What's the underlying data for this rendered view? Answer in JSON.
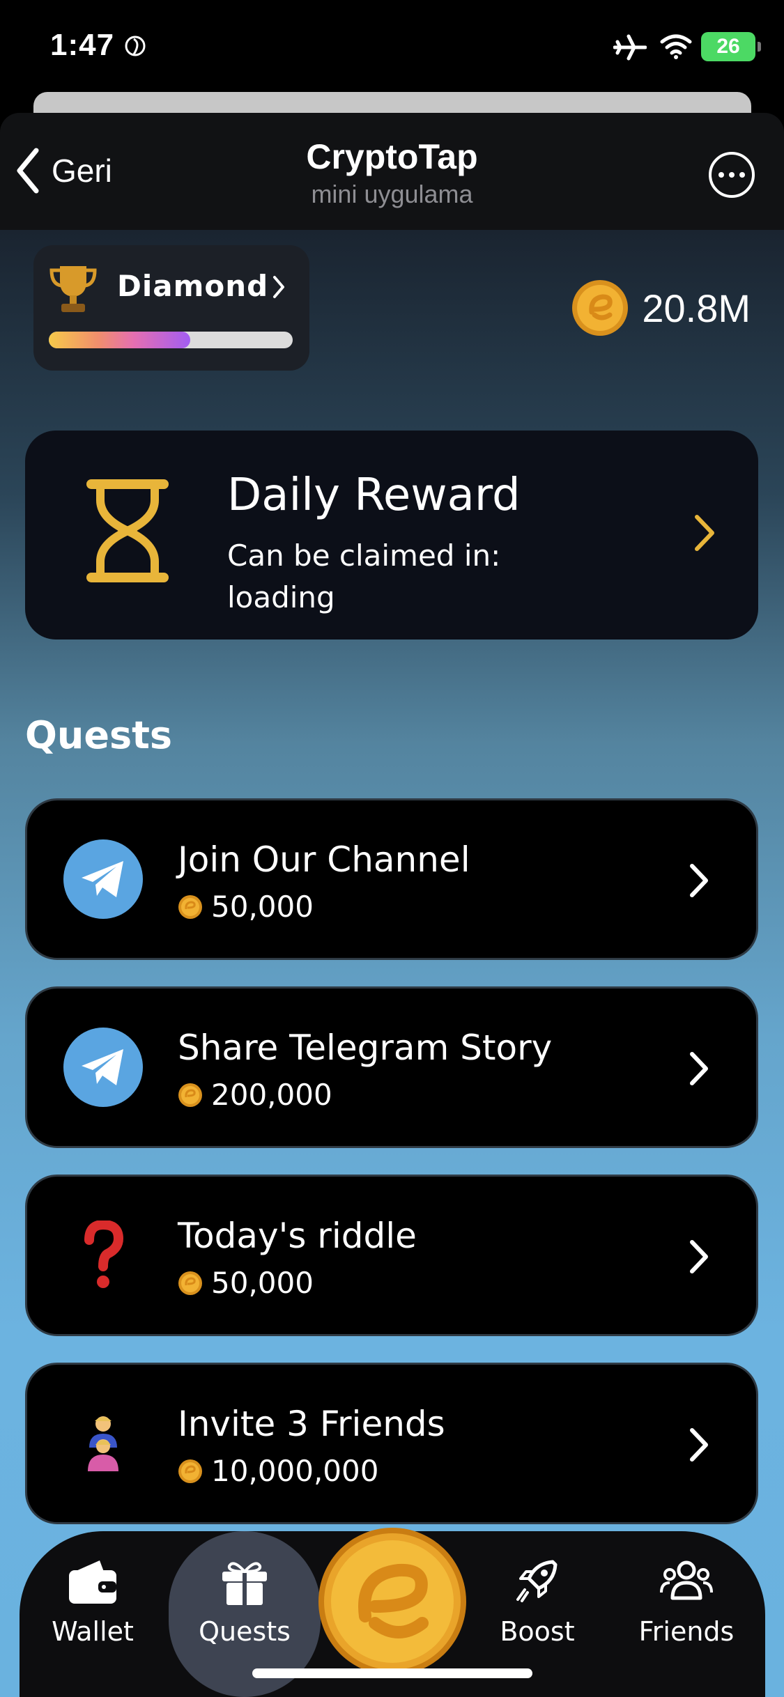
{
  "status_bar": {
    "time": "1:47",
    "battery": "26"
  },
  "header": {
    "back_label": "Geri",
    "title": "CryptoTap",
    "subtitle": "mini uygulama"
  },
  "rank": {
    "name": "Diamond",
    "progress": 0.58
  },
  "balance": {
    "value": "20.8M"
  },
  "daily_reward": {
    "title": "Daily Reward",
    "subtitle": "Can be claimed in: loading"
  },
  "quests": {
    "heading": "Quests",
    "items": [
      {
        "title": "Join Our Channel",
        "reward": "50,000",
        "icon": "telegram-icon"
      },
      {
        "title": "Share Telegram Story",
        "reward": "200,000",
        "icon": "telegram-icon"
      },
      {
        "title": "Today's riddle",
        "reward": "50,000",
        "icon": "question-mark-icon"
      },
      {
        "title": "Invite 3 Friends",
        "reward": "10,000,000",
        "icon": "family-icon"
      }
    ]
  },
  "bottom_nav": {
    "items": [
      {
        "label": "Wallet",
        "icon": "wallet-icon"
      },
      {
        "label": "Quests",
        "icon": "gift-icon",
        "active": true
      },
      {
        "label": "Boost",
        "icon": "rocket-icon"
      },
      {
        "label": "Friends",
        "icon": "friends-icon"
      }
    ]
  },
  "colors": {
    "accent_gold": "#e8b53a",
    "telegram_blue": "#5aa5e1",
    "active_tab": "#3e4452"
  }
}
